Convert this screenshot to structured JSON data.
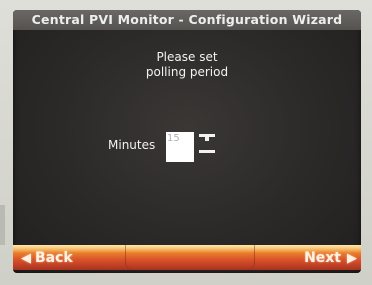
{
  "window": {
    "title": "Central PVI Monitor - Configuration Wizard"
  },
  "prompt": {
    "line1": "Please set",
    "line2": "polling period"
  },
  "minutes": {
    "label": "Minutes",
    "value": "15"
  },
  "navigation": {
    "back_label": "Back",
    "next_label": "Next"
  },
  "icons": {
    "back": "left-arrow-icon",
    "next": "right-arrow-icon",
    "increment": "increment-icon",
    "decrement": "decrement-icon"
  },
  "colors": {
    "screen_background": "#2b2928",
    "title_bar": "#5f5c59",
    "nav_bar_top": "#f6b43c",
    "nav_bar_bottom": "#a8321f",
    "text": "#f2f2f2"
  }
}
